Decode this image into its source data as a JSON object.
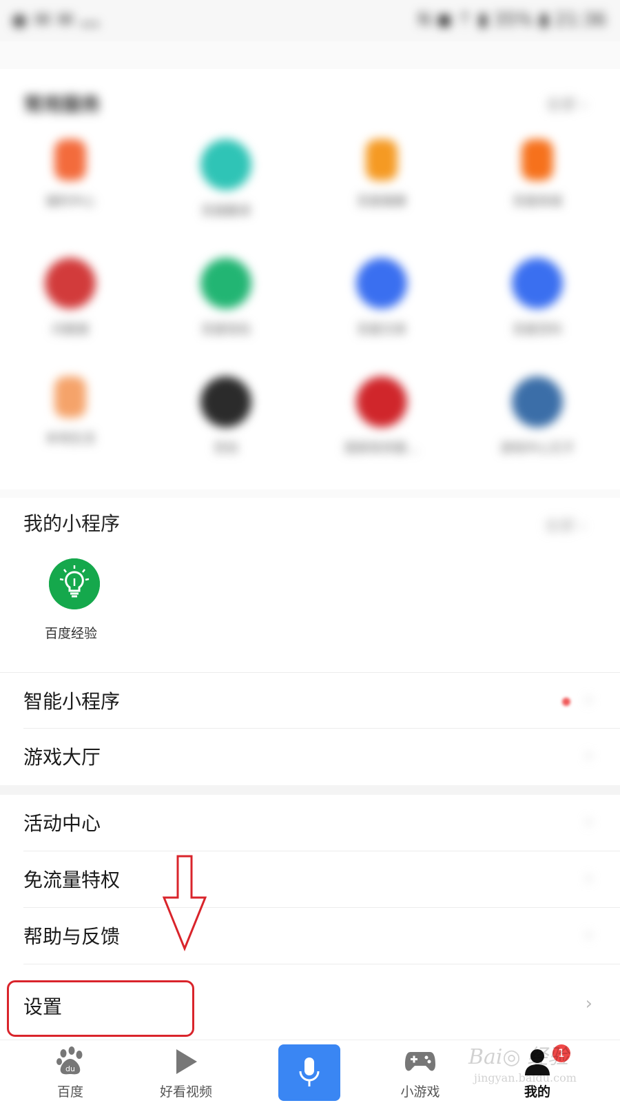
{
  "status_bar": {
    "left": "◉ ✉ ✉ …",
    "right": "N ◼ ⇡ ▮ 35% ▮ 21:36"
  },
  "services": {
    "title": "常用服务",
    "more": "全部 ›",
    "items": [
      {
        "label": "福利中心",
        "color": "#f36b3c",
        "shape": "sq"
      },
      {
        "label": "百度翻译",
        "color": "#2fc4b6",
        "shape": "round"
      },
      {
        "label": "百度健康",
        "color": "#f59a23",
        "shape": "sq"
      },
      {
        "label": "百度商城",
        "color": "#f6711c",
        "shape": "sq"
      },
      {
        "label": "问题搜",
        "color": "#d23b3b",
        "shape": "round"
      },
      {
        "label": "百度钱包",
        "color": "#22b573",
        "shape": "round"
      },
      {
        "label": "百度文库",
        "color": "#3a6ff0",
        "shape": "round"
      },
      {
        "label": "百度百科",
        "color": "#3a6ff0",
        "shape": "round"
      },
      {
        "label": "本地生活",
        "color": "#f5a36a",
        "shape": "sq"
      },
      {
        "label": "百信",
        "color": "#2b2b2b",
        "shape": "round"
      },
      {
        "label": "国家政务服…",
        "color": "#d0262b",
        "shape": "round"
      },
      {
        "label": "游戏中心王子",
        "color": "#3b6ea8",
        "shape": "round"
      }
    ]
  },
  "mini_programs": {
    "title": "我的小程序",
    "more": "全部 ›",
    "app_label": "百度经验"
  },
  "menu": {
    "smart_mini": "智能小程序",
    "game_hall": "游戏大厅",
    "activity_center": "活动中心",
    "free_data": "免流量特权",
    "help_feedback": "帮助与反馈",
    "settings": "设置",
    "chevron": "›"
  },
  "bottom_nav": {
    "baidu": "百度",
    "haokan": "好看视频",
    "minigame": "小游戏",
    "mine": "我的",
    "badge": "1"
  },
  "watermark": {
    "line1": "Bai◎ 经验",
    "line2": "jingyan.baidu.com"
  },
  "colors": {
    "accent_blue": "#3a86f3",
    "annotation_red": "#d9242b",
    "experience_green": "#15a84c"
  }
}
